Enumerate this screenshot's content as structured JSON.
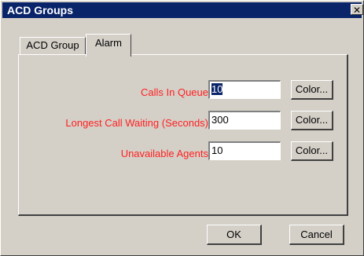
{
  "window": {
    "title": "ACD Groups",
    "close_glyph": "✕",
    "close_icon": "close-icon"
  },
  "tabs": [
    {
      "label": "ACD Group",
      "active": false
    },
    {
      "label": "Alarm",
      "active": true
    }
  ],
  "alarm": {
    "rows": [
      {
        "label": "Calls In Queue",
        "value": "10",
        "selected": true,
        "color_button": "Color..."
      },
      {
        "label": "Longest Call Waiting (Seconds)",
        "value": "300",
        "selected": false,
        "color_button": "Color..."
      },
      {
        "label": "Unavailable Agents",
        "value": "10",
        "selected": false,
        "color_button": "Color..."
      }
    ]
  },
  "buttons": {
    "ok": "OK",
    "cancel": "Cancel"
  },
  "colors": {
    "title_bar": "#0a246a",
    "label_text": "#ff2020",
    "face": "#d4d0c8",
    "selection": "#0a246a"
  }
}
